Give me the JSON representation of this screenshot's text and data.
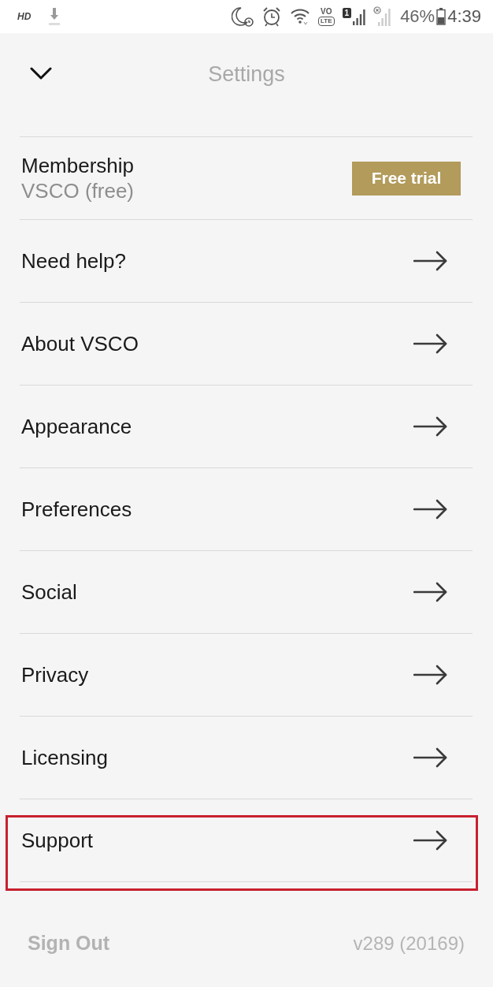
{
  "status_bar": {
    "network_label": "HD",
    "volte_top": "VO",
    "volte_bottom": "LTE",
    "sim_badge": "1",
    "battery_percent": "46%",
    "time": "4:39"
  },
  "header": {
    "title": "Settings"
  },
  "membership": {
    "label": "Membership",
    "plan": "VSCO (free)",
    "button": "Free trial"
  },
  "items": [
    {
      "label": "Need help?",
      "highlighted": false
    },
    {
      "label": "About VSCO",
      "highlighted": false
    },
    {
      "label": "Appearance",
      "highlighted": false
    },
    {
      "label": "Preferences",
      "highlighted": false
    },
    {
      "label": "Social",
      "highlighted": false
    },
    {
      "label": "Privacy",
      "highlighted": false
    },
    {
      "label": "Licensing",
      "highlighted": false
    },
    {
      "label": "Support",
      "highlighted": true
    }
  ],
  "footer": {
    "sign_out": "Sign Out",
    "version": "v289 (20169)"
  }
}
